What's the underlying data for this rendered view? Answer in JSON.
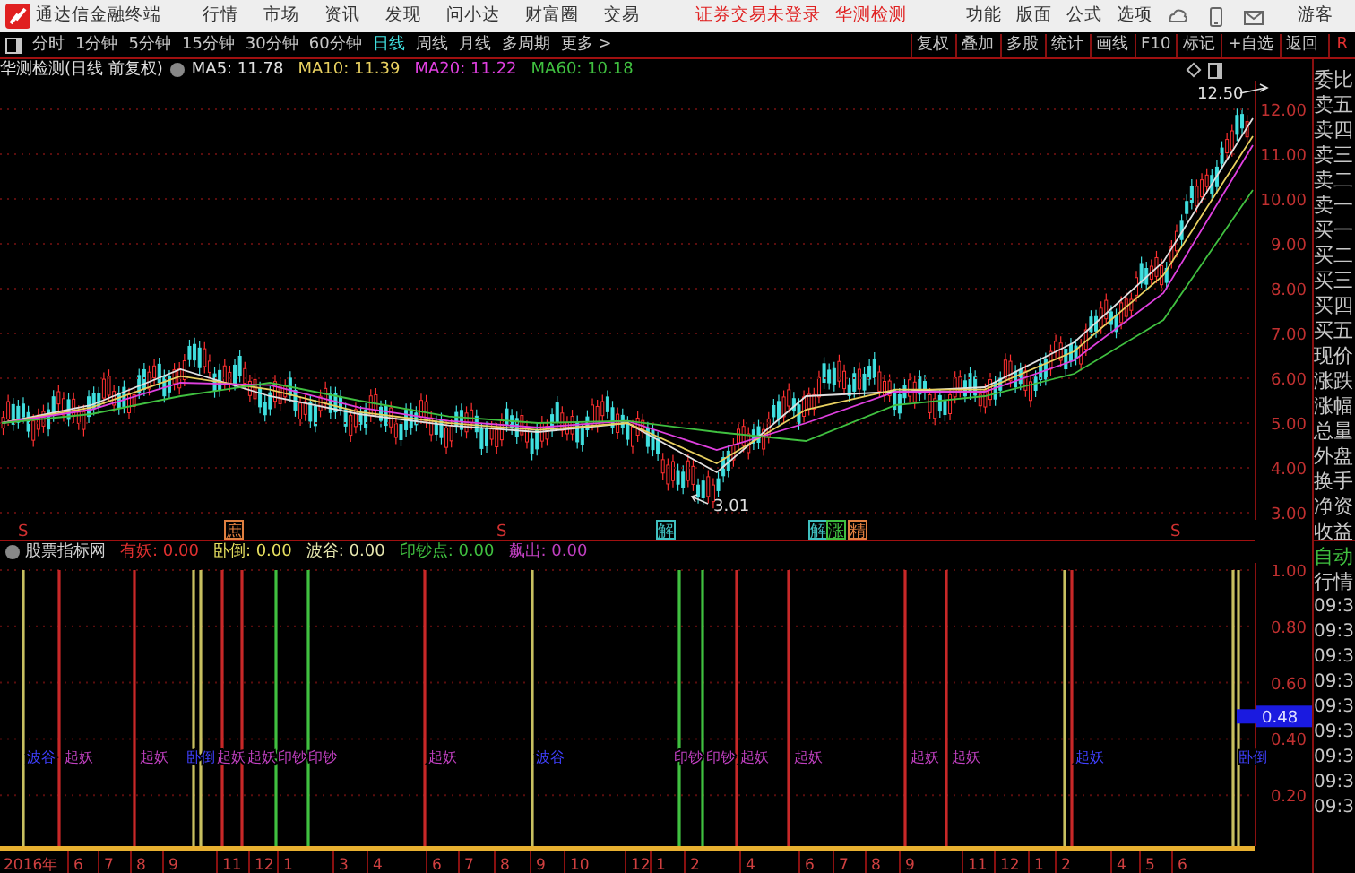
{
  "app": {
    "title": "通达信金融终端"
  },
  "menu": [
    "行情",
    "市场",
    "资讯",
    "发现",
    "问小达",
    "财富圈",
    "交易"
  ],
  "notice": {
    "status": "证券交易未登录",
    "stock": "华测检测"
  },
  "right_menu": [
    "功能",
    "版面",
    "公式",
    "选项"
  ],
  "user": "游客",
  "periods": [
    {
      "label": "分时",
      "selected": false
    },
    {
      "label": "1分钟",
      "selected": false
    },
    {
      "label": "5分钟",
      "selected": false
    },
    {
      "label": "15分钟",
      "selected": false
    },
    {
      "label": "30分钟",
      "selected": false
    },
    {
      "label": "60分钟",
      "selected": false
    },
    {
      "label": "日线",
      "selected": true
    },
    {
      "label": "周线",
      "selected": false
    },
    {
      "label": "月线",
      "selected": false
    },
    {
      "label": "多周期",
      "selected": false
    },
    {
      "label": "更多 >",
      "selected": false
    }
  ],
  "tools": [
    "复权",
    "叠加",
    "多股",
    "统计",
    "画线",
    "F10",
    "标记",
    "+自选",
    "返回"
  ],
  "corner_mark": "R",
  "main_chart": {
    "title": "华测检测(日线 前复权)",
    "ma": [
      "MA5: 11.78",
      "MA10: 11.39",
      "MA20: 11.22",
      "MA60: 10.18"
    ],
    "chart_data": {
      "type": "line",
      "grid": true,
      "ylim": [
        2.84,
        12.64
      ],
      "yticks": [
        {
          "value": 12,
          "label": "12.00"
        },
        {
          "value": 11,
          "label": "11.00"
        },
        {
          "value": 10,
          "label": "10.00"
        },
        {
          "value": 9,
          "label": "9.00"
        },
        {
          "value": 8,
          "label": "8.00"
        },
        {
          "value": 7,
          "label": "7.00"
        },
        {
          "value": 6,
          "label": "6.00"
        },
        {
          "value": 5,
          "label": "5.00"
        },
        {
          "value": 4,
          "label": "4.00"
        },
        {
          "value": 3,
          "label": "3.00"
        }
      ],
      "series": [
        {
          "color": "#e0e0e0",
          "values": [
            5.0,
            5.4,
            6.2,
            5.6,
            5.2,
            4.95,
            4.8,
            5.0,
            3.9,
            5.6,
            5.7,
            5.8,
            6.8,
            8.6,
            11.8
          ]
        },
        {
          "color": "#e8d060",
          "values": [
            5.0,
            5.35,
            6.05,
            5.75,
            5.25,
            5.0,
            4.85,
            5.0,
            4.1,
            5.3,
            5.75,
            5.75,
            6.6,
            8.3,
            11.4
          ]
        },
        {
          "color": "#e040e0",
          "values": [
            5.0,
            5.3,
            5.9,
            5.85,
            5.35,
            5.05,
            4.9,
            5.05,
            4.4,
            5.0,
            5.7,
            5.7,
            6.4,
            7.9,
            11.2
          ]
        },
        {
          "color": "#40c040",
          "values": [
            5.0,
            5.2,
            5.6,
            5.9,
            5.5,
            5.15,
            5.0,
            5.05,
            4.8,
            4.6,
            5.4,
            5.6,
            6.1,
            7.3,
            10.2
          ]
        }
      ]
    },
    "high_label": "12.50",
    "low_label": "3.01",
    "markers": [
      {
        "text": "S",
        "color": "#d03030"
      },
      {
        "text": "庶",
        "color": "#e08040"
      },
      {
        "text": "S",
        "color": "#d03030"
      },
      {
        "text": "解",
        "color": "#40c0c0"
      },
      {
        "text": "解",
        "color": "#40c0c0"
      },
      {
        "text": "涨",
        "color": "#40c040"
      },
      {
        "text": "精",
        "color": "#e08040"
      },
      {
        "text": "S",
        "color": "#d03030"
      }
    ]
  },
  "indicator": {
    "name": "股票指标网",
    "values": [
      {
        "label": "有妖: 0.00",
        "color": "#e03030"
      },
      {
        "label": "卧倒: 0.00",
        "color": "#e8e060"
      },
      {
        "label": "波谷: 0.00",
        "color": "#e8e8b0"
      },
      {
        "label": "印钞点: 0.00",
        "color": "#40c040"
      },
      {
        "label": "飙出: 0.00",
        "color": "#c040c0"
      }
    ],
    "y_ticks": [
      "1.00",
      "0.80",
      "0.60",
      "0.40",
      "0.20"
    ],
    "current": "0.48",
    "signals": [
      {
        "text": "波谷",
        "color": "#4040ff"
      },
      {
        "text": "起妖",
        "color": "#c040c0"
      },
      {
        "text": "起妖",
        "color": "#c040c0"
      },
      {
        "text": "卧倒",
        "color": "#4040ff"
      },
      {
        "text": "起妖",
        "color": "#c040c0"
      },
      {
        "text": "起妖",
        "color": "#c040c0"
      },
      {
        "text": "印钞",
        "color": "#c040c0"
      },
      {
        "text": "印钞",
        "color": "#c040c0"
      },
      {
        "text": "起妖",
        "color": "#c040c0"
      },
      {
        "text": "波谷",
        "color": "#4040ff"
      },
      {
        "text": "印钞",
        "color": "#c040c0"
      },
      {
        "text": "印钞",
        "color": "#c040c0"
      },
      {
        "text": "起妖",
        "color": "#c040c0"
      },
      {
        "text": "起妖",
        "color": "#c040c0"
      },
      {
        "text": "起妖",
        "color": "#c040c0"
      },
      {
        "text": "起妖",
        "color": "#c040c0"
      },
      {
        "text": "起妖",
        "color": "#4040ff"
      },
      {
        "text": "卧倒",
        "color": "#4040ff"
      }
    ]
  },
  "x_axis": [
    "2016年",
    "6",
    "7",
    "8",
    "9",
    "11",
    "12",
    "1",
    "3",
    "4",
    "6",
    "7",
    "8",
    "9",
    "10",
    "12",
    "1",
    "2",
    "4",
    "6",
    "7",
    "8",
    "9",
    "11",
    "12",
    "1",
    "2",
    "4",
    "5",
    "6"
  ],
  "quote_panel": {
    "fields": [
      "委比",
      "卖五",
      "卖四",
      "卖三",
      "卖二",
      "卖一",
      "买一",
      "买二",
      "买三",
      "买四",
      "买五",
      "现价",
      "涨跌",
      "涨幅",
      "总量",
      "外盘",
      "换手",
      "净资",
      "收益"
    ],
    "mode": [
      "自动",
      "行情"
    ],
    "times": [
      "09:3",
      "09:3",
      "09:3",
      "09:3",
      "09:3",
      "09:3",
      "09:3",
      "09:3",
      "09:3"
    ]
  }
}
